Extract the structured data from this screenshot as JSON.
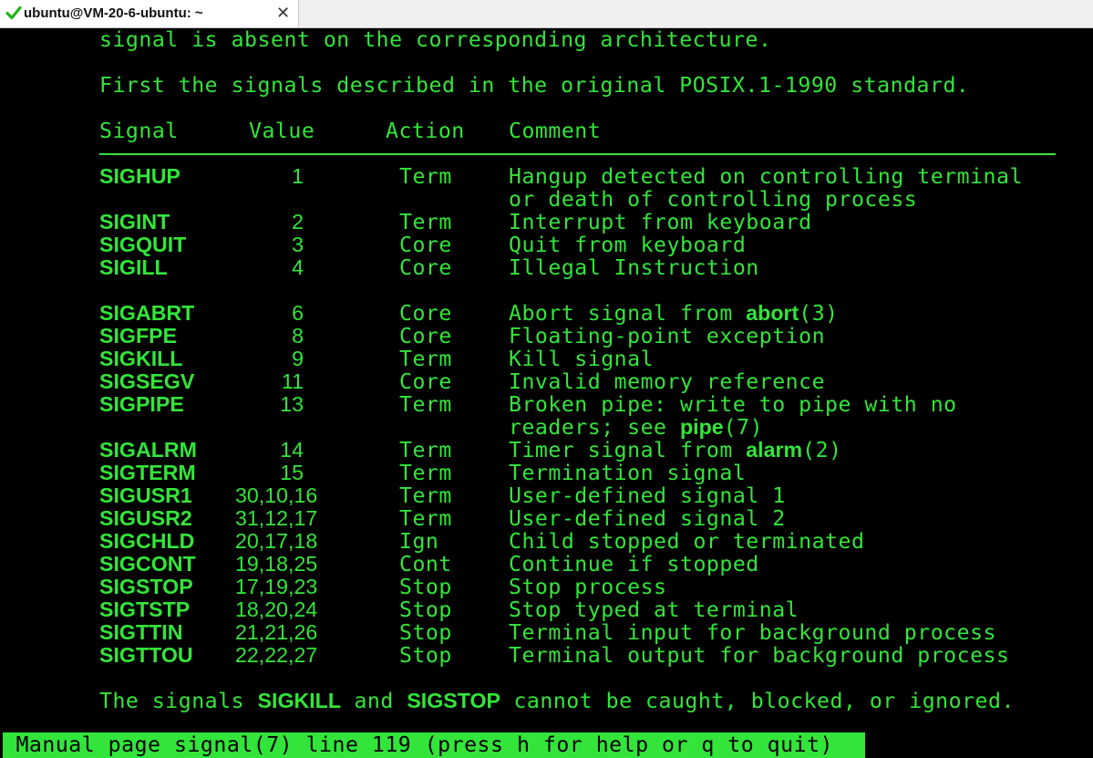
{
  "tab": {
    "title": "ubuntu@VM-20-6-ubuntu: ~",
    "close": "✕"
  },
  "text": {
    "line1": "signal is absent on the corresponding architecture.",
    "line2": "First the signals described in the original POSIX.1-1990 standard.",
    "header": {
      "signal": "Signal",
      "value": "Value",
      "action": "Action",
      "comment": "Comment"
    }
  },
  "signals": [
    {
      "name": "SIGHUP",
      "value": "1",
      "action": "Term",
      "comment": "Hangup detected on controlling terminal",
      "comment2": "or death of controlling process"
    },
    {
      "name": "SIGINT",
      "value": "2",
      "action": "Term",
      "comment": "Interrupt from keyboard"
    },
    {
      "name": "SIGQUIT",
      "value": "3",
      "action": "Core",
      "comment": "Quit from keyboard"
    },
    {
      "name": "SIGILL",
      "value": "4",
      "action": "Core",
      "comment": "Illegal Instruction"
    },
    {
      "name": "SIGABRT",
      "value": "6",
      "action": "Core",
      "comment_pre": "Abort signal from ",
      "comment_bold": "abort",
      "comment_post": "(3)"
    },
    {
      "name": "SIGFPE",
      "value": "8",
      "action": "Core",
      "comment": "Floating-point exception"
    },
    {
      "name": "SIGKILL",
      "value": "9",
      "action": "Term",
      "comment": "Kill signal"
    },
    {
      "name": "SIGSEGV",
      "value": "11",
      "action": "Core",
      "comment": "Invalid memory reference"
    },
    {
      "name": "SIGPIPE",
      "value": "13",
      "action": "Term",
      "comment": "Broken pipe: write to pipe with no",
      "comment2_pre": "readers; see ",
      "comment2_bold": "pipe",
      "comment2_post": "(7)"
    },
    {
      "name": "SIGALRM",
      "value": "14",
      "action": "Term",
      "comment_pre": "Timer signal from ",
      "comment_bold": "alarm",
      "comment_post": "(2)"
    },
    {
      "name": "SIGTERM",
      "value": "15",
      "action": "Term",
      "comment": "Termination signal"
    },
    {
      "name": "SIGUSR1",
      "value": "30,10,16",
      "action": "Term",
      "comment": "User-defined signal 1"
    },
    {
      "name": "SIGUSR2",
      "value": "31,12,17",
      "action": "Term",
      "comment": "User-defined signal 2"
    },
    {
      "name": "SIGCHLD",
      "value": "20,17,18",
      "action": "Ign",
      "comment": "Child stopped or terminated"
    },
    {
      "name": "SIGCONT",
      "value": "19,18,25",
      "action": "Cont",
      "comment": "Continue if stopped"
    },
    {
      "name": "SIGSTOP",
      "value": "17,19,23",
      "action": "Stop",
      "comment": "Stop process"
    },
    {
      "name": "SIGTSTP",
      "value": "18,20,24",
      "action": "Stop",
      "comment": "Stop typed at terminal"
    },
    {
      "name": "SIGTTIN",
      "value": "21,21,26",
      "action": "Stop",
      "comment": "Terminal input for background process"
    },
    {
      "name": "SIGTTOU",
      "value": "22,22,27",
      "action": "Stop",
      "comment": "Terminal output for background process"
    }
  ],
  "footer": {
    "pre": "The signals ",
    "b1": "SIGKILL",
    "mid": " and ",
    "b2": "SIGSTOP",
    "post": " cannot be caught, blocked, or ignored."
  },
  "status": " Manual page signal(7) line 119 (press h for help or q to quit)",
  "colors": {
    "fg": "#33e53a",
    "bg": "#000000",
    "check": "#1db31d"
  }
}
